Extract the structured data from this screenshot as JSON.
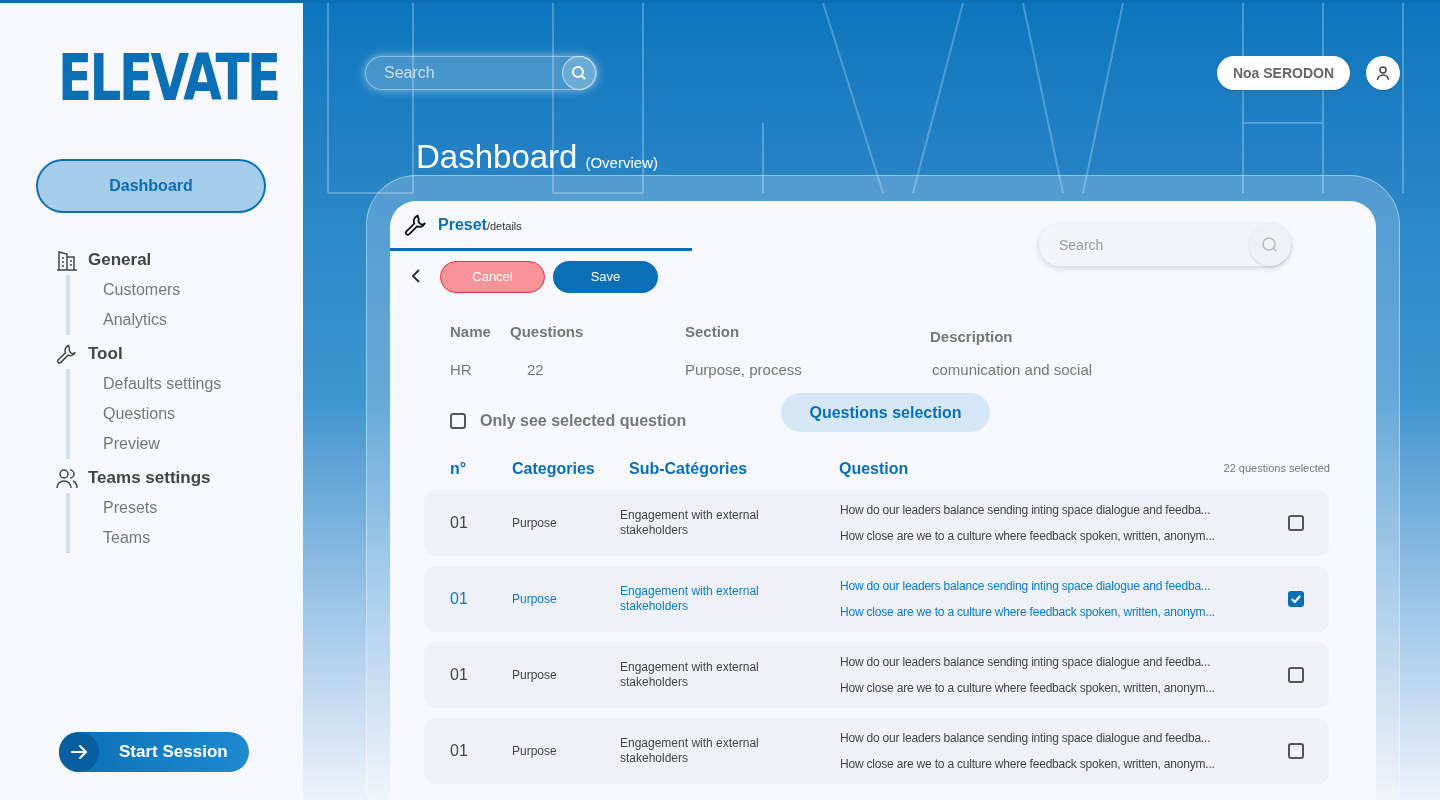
{
  "sidebar": {
    "logo": "ELEVATE",
    "nav_button": {
      "label": "Dashboard",
      "selected": true
    },
    "groups": [
      {
        "label": "General",
        "items": [
          {
            "label": "Customers"
          },
          {
            "label": "Analytics"
          }
        ]
      },
      {
        "label": "Tool",
        "items": [
          {
            "label": "Defaults settings"
          },
          {
            "label": "Questions"
          },
          {
            "label": "Preview"
          }
        ]
      },
      {
        "label": "Teams settings",
        "items": [
          {
            "label": "Presets"
          },
          {
            "label": "Teams"
          }
        ]
      }
    ],
    "start_button": "Start Session"
  },
  "header": {
    "search": {
      "placeholder": "Search"
    },
    "user_name": "Noa SERODON"
  },
  "page_title": "Dashboard",
  "page_subtitle": "(Overview)",
  "panel": {
    "tab": {
      "title": "Preset",
      "subtitle": "/details"
    },
    "search": {
      "placeholder": "Search"
    },
    "cancel": "Cancel",
    "save": "Save",
    "info": [
      {
        "label": "Name",
        "value": "HR"
      },
      {
        "label": "Questions",
        "value": "22"
      },
      {
        "label": "Section",
        "value": "Purpose, process"
      },
      {
        "label": "Description",
        "value": "comunication and social"
      }
    ],
    "filter": {
      "label": "Only see selected question",
      "checked": false
    },
    "selection_button": "Questions selection",
    "table": {
      "columns": [
        "n°",
        "Categories",
        "Sub-Catégories",
        "Question"
      ],
      "count": "22 questions selected",
      "rows": [
        {
          "number": "01",
          "category": "Purpose",
          "subcategory": "Engagement with external stakeholders",
          "questions": [
            "How do our leaders balance sending inting space dialogue and feedba...",
            "How close are we to a culture where feedback spoken, written, anonym..."
          ],
          "selected": false
        },
        {
          "number": "01",
          "category": "Purpose",
          "subcategory": "Engagement with external stakeholders",
          "questions": [
            "How do our leaders balance sending inting space dialogue and feedba...",
            "How close are we to a culture where feedback spoken, written, anonym..."
          ],
          "selected": true
        },
        {
          "number": "01",
          "category": "Purpose",
          "subcategory": "Engagement with external stakeholders",
          "questions": [
            "How do our leaders balance sending inting space dialogue and feedba...",
            "How close are we to a culture where feedback spoken, written, anonym..."
          ],
          "selected": false
        },
        {
          "number": "01",
          "category": "Purpose",
          "subcategory": "Engagement with external stakeholders",
          "questions": [
            "How do our leaders balance sending inting space dialogue and feedba...",
            "How close are we to a culture where feedback spoken, written, anonym..."
          ],
          "selected": false
        }
      ]
    }
  }
}
